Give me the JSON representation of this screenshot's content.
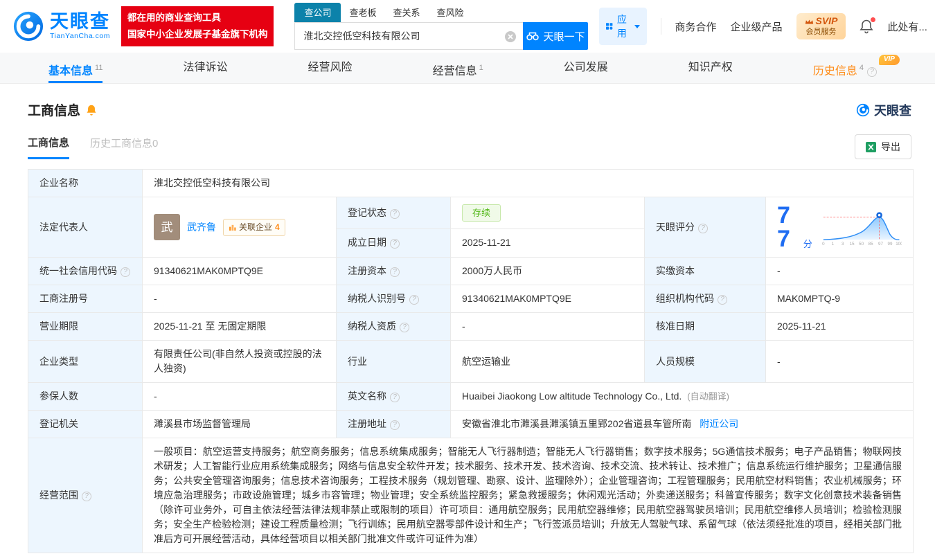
{
  "brand": {
    "logo_cn": "天眼查",
    "logo_en": "TianYanCha.com",
    "banner_line1": "都在用的商业查询工具",
    "banner_line2": "国家中小企业发展子基金旗下机构"
  },
  "search": {
    "tabs": [
      "查公司",
      "查老板",
      "查关系",
      "查风险"
    ],
    "value": "淮北交控低空科技有限公司",
    "button": "天眼一下"
  },
  "topnav": {
    "apps": "应用",
    "biz_coop": "商务合作",
    "enterprise": "企业级产品",
    "svip_line1": "SVIP",
    "svip_line2": "会员服务",
    "more": "此处有..."
  },
  "tabs": {
    "basic": "基本信息",
    "basic_count": "11",
    "legal": "法律诉讼",
    "risk": "经营风险",
    "operation": "经营信息",
    "operation_count": "1",
    "development": "公司发展",
    "ip": "知识产权",
    "history": "历史信息",
    "history_count": "4",
    "history_vip": "VIP"
  },
  "section": {
    "title": "工商信息",
    "watermark": "天眼查",
    "subtab_active": "工商信息",
    "subtab_history": "历史工商信息0",
    "export_label": "导出"
  },
  "info": {
    "company_name": {
      "label": "企业名称",
      "value": "淮北交控低空科技有限公司"
    },
    "legal_rep": {
      "label": "法定代表人",
      "avatar": "武",
      "name": "武齐鲁",
      "related_label": "关联企业",
      "related_count": "4"
    },
    "reg_status": {
      "label": "登记状态",
      "value": "存续"
    },
    "establish_date": {
      "label": "成立日期",
      "value": "2025-11-21"
    },
    "tyc_score": {
      "label": "天眼评分"
    },
    "credit_code": {
      "label": "统一社会信用代码",
      "value": "91340621MAK0MPTQ9E"
    },
    "reg_capital": {
      "label": "注册资本",
      "value": "2000万人民币"
    },
    "paid_capital": {
      "label": "实缴资本",
      "value": "-"
    },
    "reg_no": {
      "label": "工商注册号",
      "value": "-"
    },
    "taxpayer_no": {
      "label": "纳税人识别号",
      "value": "91340621MAK0MPTQ9E"
    },
    "org_code": {
      "label": "组织机构代码",
      "value": "MAK0MPTQ-9"
    },
    "term": {
      "label": "营业期限",
      "value": "2025-11-21 至 无固定期限"
    },
    "taxpayer_qual": {
      "label": "纳税人资质",
      "value": "-"
    },
    "approve_date": {
      "label": "核准日期",
      "value": "2025-11-21"
    },
    "company_type": {
      "label": "企业类型",
      "value": "有限责任公司(非自然人投资或控股的法人独资)"
    },
    "industry": {
      "label": "行业",
      "value": "航空运输业"
    },
    "staff_size": {
      "label": "人员规模",
      "value": "-"
    },
    "insured": {
      "label": "参保人数",
      "value": "-"
    },
    "en_name": {
      "label": "英文名称",
      "value": "Huaibei Jiaokong Low altitude Technology Co., Ltd.",
      "note": "(自动翻译)"
    },
    "authority": {
      "label": "登记机关",
      "value": "濉溪县市场监督管理局"
    },
    "address": {
      "label": "注册地址",
      "value": "安徽省淮北市濉溪县濉溪镇五里郢202省道县车管所南",
      "link": "附近公司"
    },
    "scope": {
      "label": "经营范围",
      "value": "一般项目：航空运营支持服务；航空商务服务；信息系统集成服务；智能无人飞行器制造；智能无人飞行器销售；数字技术服务；5G通信技术服务；电子产品销售；物联网技术研发；人工智能行业应用系统集成服务；网络与信息安全软件开发；技术服务、技术开发、技术咨询、技术交流、技术转让、技术推广；信息系统运行维护服务；卫星通信服务；公共安全管理咨询服务；信息技术咨询服务；工程技术服务（规划管理、勘察、设计、监理除外）；企业管理咨询；工程管理服务；民用航空材料销售；农业机械服务；环境应急治理服务；市政设施管理；城乡市容管理；物业管理；安全系统监控服务；紧急救援服务；休闲观光活动；外卖递送服务；科普宣传服务；数字文化创意技术装备销售（除许可业务外，可自主依法经营法律法规非禁止或限制的项目）许可项目：通用航空服务；民用航空器维修；民用航空器驾驶员培训；民用航空维修人员培训；检验检测服务；安全生产检验检测；建设工程质量检测；飞行训练；民用航空器零部件设计和生产；飞行签派员培训；升放无人驾驶气球、系留气球（依法须经批准的项目，经相关部门批准后方可开展经营活动，具体经营项目以相关部门批准文件或许可证件为准）"
    }
  },
  "score_chart": {
    "type": "area",
    "score": "77",
    "unit": "分",
    "axis_labels": [
      "0",
      "1",
      "3",
      "15",
      "50",
      "85",
      "97",
      "99",
      "100"
    ]
  },
  "colors": {
    "accent_blue": "#0084ff",
    "brand_red": "#e60012",
    "search_tab_teal": "#0c82aa",
    "history_orange": "#ff8c19",
    "status_green": "#52b818",
    "label_bg": "#edf6fe",
    "link_blue": "#0084ff"
  }
}
